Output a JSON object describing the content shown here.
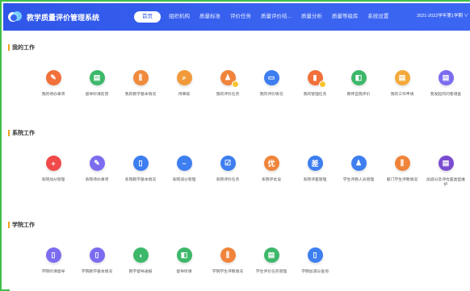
{
  "header": {
    "app_title": "教学质量评价管理系统",
    "year_selector": "2021-2022学年第1学期 ∨",
    "nav": [
      "首页",
      "组织机构",
      "质量标准",
      "评价任务",
      "质量评价结...",
      "质量分析",
      "质量等级库",
      "系统设置"
    ],
    "active_nav": 0
  },
  "sections": [
    {
      "title": "我的工作",
      "tiles": [
        {
          "label": "我的待办事项",
          "color": "#f2703a",
          "glyph": "✎",
          "shape": "round",
          "badge": false
        },
        {
          "label": "督导听课反馈",
          "color": "#3db86a",
          "glyph": "▤",
          "shape": "round",
          "badge": false
        },
        {
          "label": "我的教学基本情况",
          "color": "#f08a3c",
          "glyph": "⫼",
          "shape": "round",
          "badge": false
        },
        {
          "label": "待审核",
          "color": "#f29a3a",
          "glyph": "⌕",
          "shape": "round",
          "badge": false
        },
        {
          "label": "我的评价任务",
          "color": "#f0843a",
          "glyph": "♟",
          "shape": "round",
          "badge": true
        },
        {
          "label": "我的评价情况",
          "color": "#3d7ef0",
          "glyph": "▭",
          "shape": "round",
          "badge": false
        },
        {
          "label": "我的管理任务",
          "color": "#f2703a",
          "glyph": "▮",
          "shape": "round",
          "badge": true
        },
        {
          "label": "教师自我评价",
          "color": "#3db86a",
          "glyph": "◧",
          "shape": "round",
          "badge": false
        },
        {
          "label": "我的工作申请",
          "color": "#f3a93a",
          "glyph": "▤",
          "shape": "round",
          "badge": false
        },
        {
          "label": "我发起的问卷调查",
          "color": "#7b6cf0",
          "glyph": "▤",
          "shape": "round",
          "badge": false
        }
      ]
    },
    {
      "title": "系院工作",
      "tiles": [
        {
          "label": "系院加分管理",
          "color": "#f04a4a",
          "glyph": "+",
          "shape": "round",
          "badge": false
        },
        {
          "label": "系院待办事项",
          "color": "#7b6cf0",
          "glyph": "✎",
          "shape": "round",
          "badge": false
        },
        {
          "label": "系院教学基本情况",
          "color": "#3d7ef0",
          "glyph": "▯",
          "shape": "round",
          "badge": false
        },
        {
          "label": "系院减分管理",
          "color": "#3d7ef0",
          "glyph": "−",
          "shape": "round",
          "badge": false
        },
        {
          "label": "系院评价任务",
          "color": "#3d7ef0",
          "glyph": "☑",
          "shape": "round",
          "badge": false
        },
        {
          "label": "系院评优设",
          "color": "#f0843a",
          "glyph": "优",
          "shape": "round",
          "badge": false
        },
        {
          "label": "系院评差管理",
          "color": "#3d7ef0",
          "glyph": "差",
          "shape": "round",
          "badge": false
        },
        {
          "label": "学生评教人员管理",
          "color": "#3d7ef0",
          "glyph": "♟",
          "shape": "round",
          "badge": false
        },
        {
          "label": "部门学生评教情况",
          "color": "#f0843a",
          "glyph": "⫼",
          "shape": "round",
          "badge": false
        },
        {
          "label": "加减分及评优差类型维护",
          "color": "#7b4cd0",
          "glyph": "▤",
          "shape": "round",
          "badge": false
        }
      ]
    },
    {
      "title": "学院工作",
      "tiles": [
        {
          "label": "学院听课督导",
          "color": "#7b6cf0",
          "glyph": "▯",
          "shape": "round",
          "badge": false
        },
        {
          "label": "学院教学基本情况",
          "color": "#7b6cf0",
          "glyph": "▯",
          "shape": "round",
          "badge": false
        },
        {
          "label": "教学督导通报",
          "color": "#3db86a",
          "glyph": "◖",
          "shape": "round",
          "badge": false
        },
        {
          "label": "督导听课",
          "color": "#3db86a",
          "glyph": "◧",
          "shape": "round",
          "badge": false
        },
        {
          "label": "学院学生评教情况",
          "color": "#f0843a",
          "glyph": "⫼",
          "shape": "round",
          "badge": false
        },
        {
          "label": "学生评价任务管理",
          "color": "#3db86a",
          "glyph": "▤",
          "shape": "round",
          "badge": false
        },
        {
          "label": "学院加减分查询",
          "color": "#3d7ef0",
          "glyph": "▯",
          "shape": "round",
          "badge": false
        }
      ]
    }
  ]
}
